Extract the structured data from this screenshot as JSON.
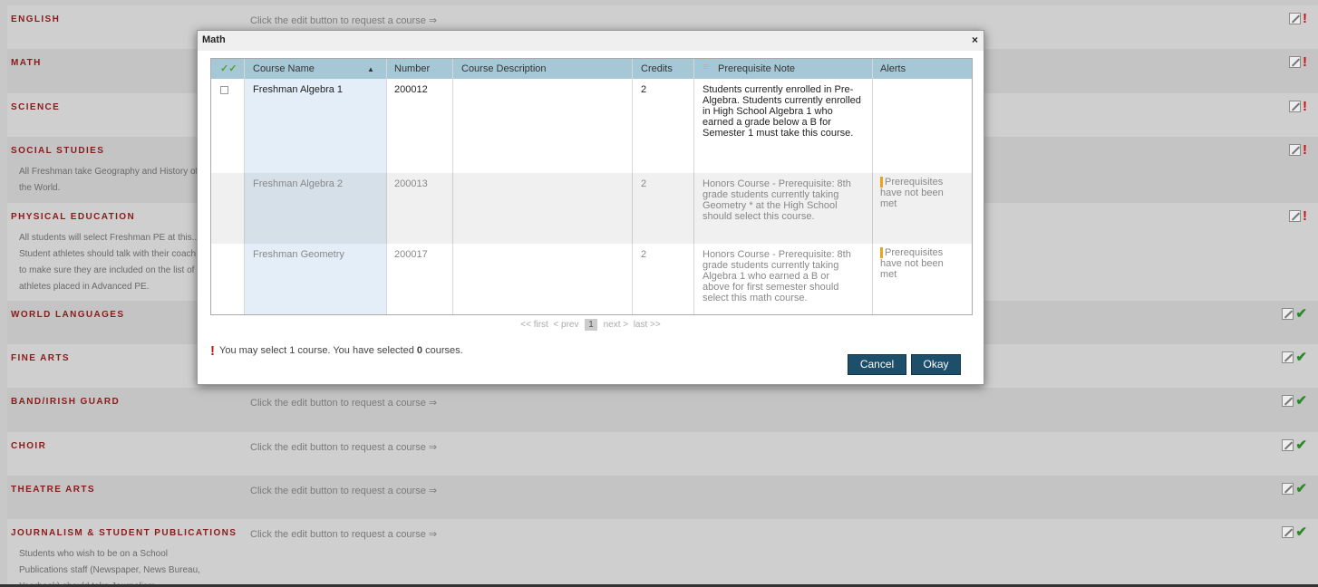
{
  "categories": [
    {
      "name": "English",
      "hint": "Click the edit button to request a course ⇒",
      "desc": "",
      "status": "warn"
    },
    {
      "name": "Math",
      "hint": "",
      "desc": "",
      "status": "warn"
    },
    {
      "name": "Science",
      "hint": "",
      "desc": "",
      "status": "warn"
    },
    {
      "name": "Social Studies",
      "hint": "",
      "desc": "All Freshman take Geography and History of the World.",
      "status": "warn"
    },
    {
      "name": "Physical Education",
      "hint": "",
      "desc": "All students will select Freshman PE at this... Student athletes should talk with their coach to make sure they are included on the list of athletes placed in Advanced PE.",
      "status": "warn"
    },
    {
      "name": "World Languages",
      "hint": "",
      "desc": "",
      "status": "ok"
    },
    {
      "name": "Fine Arts",
      "hint": "",
      "desc": "",
      "status": "ok"
    },
    {
      "name": "Band/Irish Guard",
      "hint": "Click the edit button to request a course ⇒",
      "desc": "",
      "status": "ok"
    },
    {
      "name": "Choir",
      "hint": "Click the edit button to request a course ⇒",
      "desc": "",
      "status": "ok"
    },
    {
      "name": "Theatre Arts",
      "hint": "Click the edit button to request a course ⇒",
      "desc": "",
      "status": "ok"
    },
    {
      "name": "Journalism & Student Publications",
      "hint": "Click the edit button to request a course ⇒",
      "desc": "Students who wish to be on a School Publications staff (Newspaper, News Bureau, Yearbook) should take Journalism.",
      "status": "ok"
    }
  ],
  "modal": {
    "title": "Math",
    "close": "×",
    "headers": {
      "course_name": "Course Name",
      "number": "Number",
      "description": "Course Description",
      "credits": "Credits",
      "prereq": "Prerequisite Note",
      "alerts": "Alerts"
    },
    "sort_indicator": "▲",
    "rows": [
      {
        "name": "Freshman Algebra 1",
        "number": "200012",
        "description": "",
        "credits": "2",
        "prereq": "Students currently enrolled in Pre-Algebra. Students currently enrolled in High School Algebra 1 who earned a grade below a B for Semester 1 must take this course.",
        "alert": ""
      },
      {
        "name": "Freshman Algebra 2",
        "number": "200013",
        "description": "",
        "credits": "2",
        "prereq": "Honors Course - Prerequisite: 8th grade students currently taking Geometry * at the High School should select this course.",
        "alert": "Prerequisites have not been met"
      },
      {
        "name": "Freshman Geometry",
        "number": "200017",
        "description": "",
        "credits": "2",
        "prereq": "Honors Course - Prerequisite: 8th grade students currently taking Algebra 1 who earned a B or above for first semester should select this math course.",
        "alert": "Prerequisites have not been met"
      }
    ],
    "pager": {
      "first": "<< first",
      "prev": "< prev",
      "current": "1",
      "next": "next >",
      "last": "last >>"
    },
    "select_msg_prefix": "You may select 1 course. You have selected ",
    "select_count": "0",
    "select_msg_suffix": " courses.",
    "cancel": "Cancel",
    "okay": "Okay"
  },
  "colors": {
    "category_text": "#8b1a1a",
    "header_bg": "#a6c8d6",
    "button": "#1d4e6a",
    "warn": "#cc1111",
    "ok": "#2a8a2a"
  }
}
